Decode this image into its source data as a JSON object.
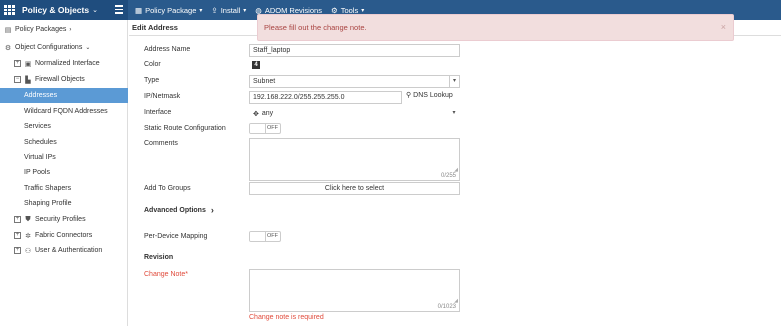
{
  "app": {
    "title": "Policy & Objects",
    "title_chevron": "⌄",
    "menu_icon": "hamburger-icon"
  },
  "topnav": [
    {
      "label": "Policy Package",
      "icon": "package-icon",
      "glyph": "▦",
      "has_dropdown": true
    },
    {
      "label": "Install",
      "icon": "install-icon",
      "glyph": "⇪",
      "has_dropdown": true
    },
    {
      "label": "ADOM Revisions",
      "icon": "globe-icon",
      "glyph": "◍",
      "has_dropdown": false
    },
    {
      "label": "Tools",
      "icon": "wrench-icon",
      "glyph": "⚙",
      "has_dropdown": true
    }
  ],
  "sidebar": {
    "items": [
      {
        "label": "Policy Packages",
        "chev": "›"
      },
      {
        "label": "Object Configurations",
        "chev": "⌄"
      },
      {
        "label": "Normalized Interface"
      },
      {
        "label": "Firewall Objects"
      },
      {
        "label": "Addresses"
      },
      {
        "label": "Wildcard FQDN Addresses"
      },
      {
        "label": "Services"
      },
      {
        "label": "Schedules"
      },
      {
        "label": "Virtual IPs"
      },
      {
        "label": "IP Pools"
      },
      {
        "label": "Traffic Shapers"
      },
      {
        "label": "Shaping Profile"
      },
      {
        "label": "Security Profiles"
      },
      {
        "label": "Fabric Connectors"
      },
      {
        "label": "User & Authentication"
      }
    ]
  },
  "form": {
    "heading": "Edit Address",
    "address_name_label": "Address Name",
    "address_name_value": "Staff_laptop",
    "color_label": "Color",
    "color_value": "4",
    "type_label": "Type",
    "type_value": "Subnet",
    "ipnetmask_label": "IP/Netmask",
    "ipnetmask_value": "192.168.222.0/255.255.255.0",
    "dns_lookup_label": "DNS Lookup",
    "interface_label": "Interface",
    "interface_value": "any",
    "static_route_label": "Static Route Configuration",
    "static_route_state": "OFF",
    "comments_label": "Comments",
    "comments_counter": "0/255",
    "add_to_groups_label": "Add To Groups",
    "add_to_groups_button": "Click here to select",
    "advanced_options_label": "Advanced Options",
    "per_device_label": "Per-Device Mapping",
    "per_device_state": "OFF",
    "revision_label": "Revision",
    "change_note_label": "Change Note",
    "change_note_required_mark": "*",
    "change_note_counter": "0/1023",
    "change_note_error": "Change note is required"
  },
  "alert": {
    "message": "Please fill out the change note.",
    "close": "×"
  },
  "colors": {
    "topbar": "#2a5a8c",
    "sidebar_active": "#5b9ad5",
    "error": "#e04b3c",
    "alert_bg": "#f2dede"
  }
}
